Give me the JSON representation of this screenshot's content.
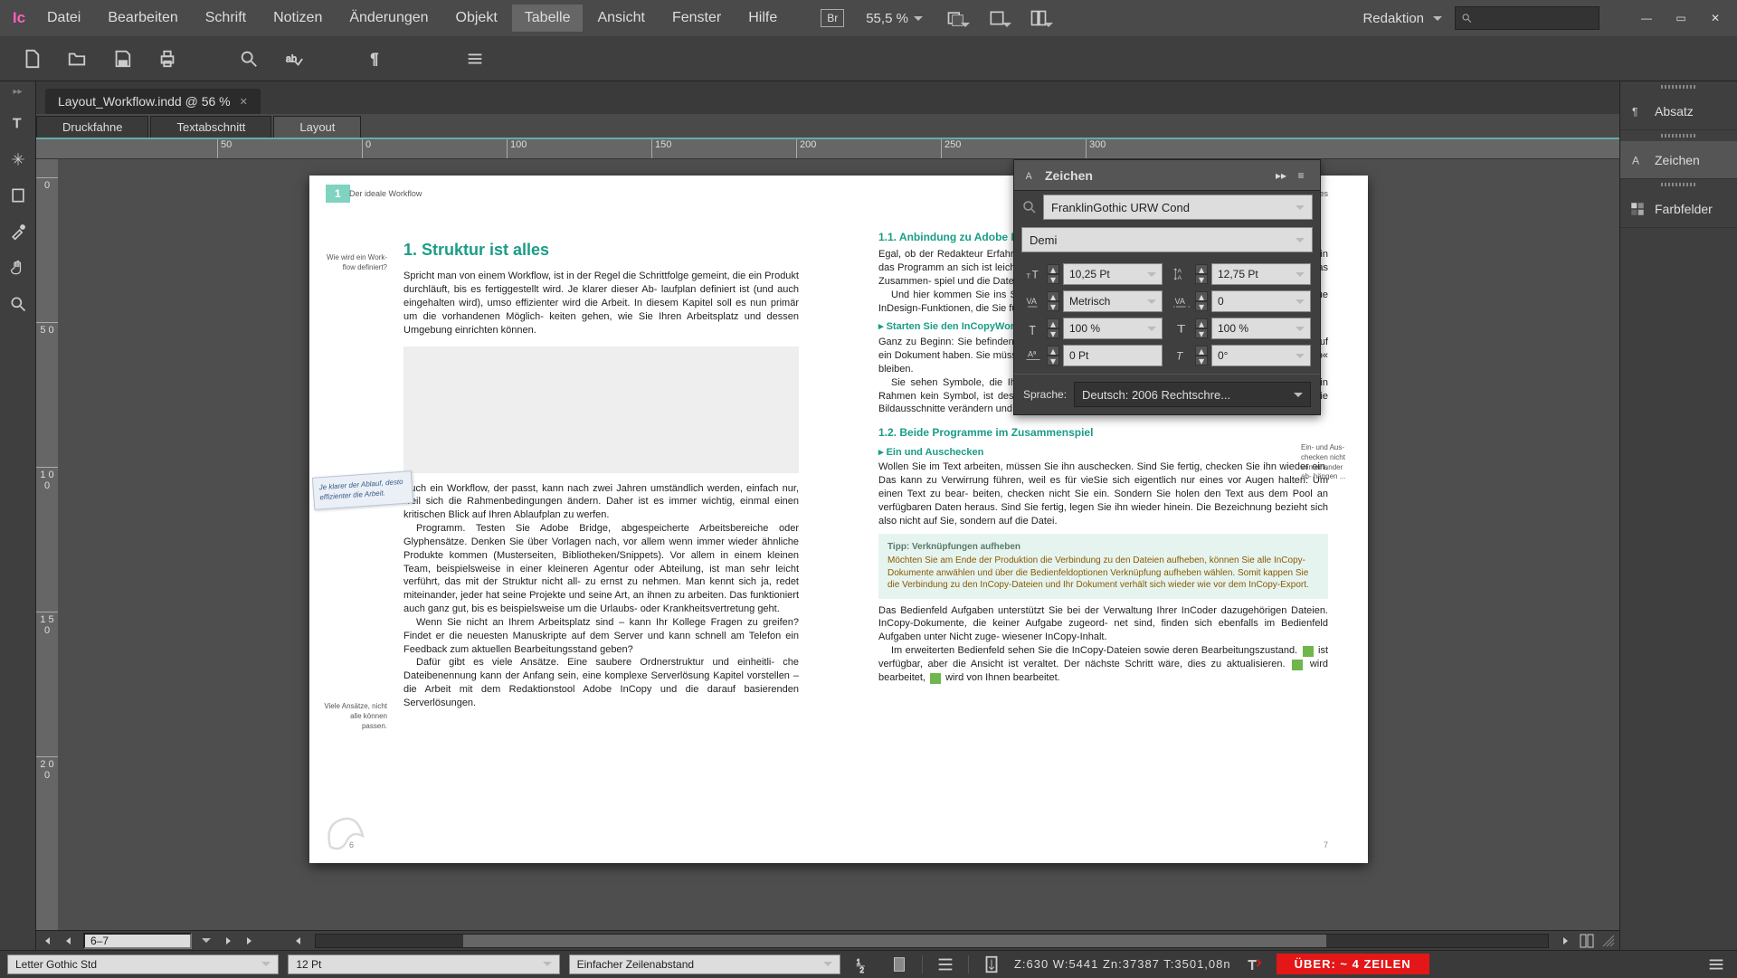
{
  "app": {
    "icon_label": "Ic"
  },
  "menu": [
    "Datei",
    "Bearbeiten",
    "Schrift",
    "Notizen",
    "Änderungen",
    "Objekt",
    "Tabelle",
    "Ansicht",
    "Fenster",
    "Hilfe"
  ],
  "menu_highlight": 6,
  "br_badge": "Br",
  "zoom": "55,5 %",
  "workspace_label": "Redaktion",
  "search_placeholder": "",
  "window_buttons": {
    "minimize": "—",
    "maximize": "▭",
    "close": "✕"
  },
  "document_tab": {
    "name": "Layout_Workflow.indd @ 56 %"
  },
  "view_tabs": [
    "Druckfahne",
    "Textabschnitt",
    "Layout"
  ],
  "view_tab_active": 2,
  "ruler_h": [
    "50",
    "100",
    "150",
    "200",
    "250",
    "300"
  ],
  "ruler_v": [
    "0",
    "5 0",
    "1 0 0",
    "1 5 0",
    "2 0 0"
  ],
  "page_nav": {
    "current": "6–7"
  },
  "left_page": {
    "chapmark": "1",
    "running": "Der ideale Workflow",
    "h1": "1.  Struktur ist alles",
    "marg1": "Wie wird ein Work- flow definiert?",
    "p1": "Spricht man von einem Workflow, ist in der Regel die Schrittfolge gemeint, die ein Produkt durchläuft, bis es fertiggestellt wird. Je klarer dieser Ab- laufplan definiert ist (und auch eingehalten wird), umso effizienter wird die Arbeit. In diesem Kapitel soll es nun primär um die vorhandenen Möglich- keiten gehen, wie Sie Ihren Arbeitsplatz und dessen Umgebung einrichten können.",
    "sticky": "Je klarer der Ablauf, desto effizienter die Arbeit.",
    "p2": "Auch ein Workflow, der passt, kann nach zwei Jahren umständlich werden, einfach nur, weil sich die Rahmenbedingungen ändern. Daher ist es immer wichtig, einmal einen kritischen Blick auf Ihren Ablaufplan zu werfen.",
    "p3": "Programm. Testen Sie Adobe Bridge, abgespeicherte Arbeitsbereiche oder Glyphensätze. Denken Sie über Vorlagen nach, vor allem wenn immer wieder ähnliche Produkte kommen (Musterseiten, Bibliotheken/Snippets). Vor allem in einem kleinen Team, beispielsweise in einer kleineren Agentur oder Abteilung, ist man sehr leicht verführt, das mit der Struktur nicht all- zu ernst zu nehmen. Man kennt sich ja, redet miteinander, jeder hat seine Projekte und seine Art, an ihnen zu arbeiten. Das funktioniert auch ganz gut, bis es beispielsweise um die Urlaubs- oder Krankheitsvertretung geht.",
    "p4": "Wenn Sie nicht an Ihrem Arbeitsplatz sind – kann Ihr Kollege Fragen zu greifen? Findet er die neuesten Manuskripte auf dem Server und kann schnell am Telefon ein Feedback zum aktuellen Bearbeitungsstand geben?",
    "marg2": "Viele Ansätze, nicht alle können passen.",
    "p5": "Dafür gibt es viele Ansätze. Eine saubere Ordnerstruktur und einheitli- che Dateibenennung kann der Anfang sein, eine komplexe Serverlösung Kapitel vorstellen – die Arbeit mit dem Redaktionstool Adobe InCopy und die darauf basierenden Serverlösungen.",
    "foot": "6"
  },
  "right_page": {
    "running": "Struktur ist alles",
    "h2a": "1.1.  Anbindung zu Adobe InCopy",
    "p1": "Egal, ob der Redakteur Erfahrungen in InDesign hat oder lediglich Word-Kenntnisse: Der Einstieg in das Programm an sich ist leicht. Worauf sich Redakteur und Layouter aber einstellen müssen, ist das Zusammen- spiel und die Dateiverwaltung der Programme.",
    "p1b": "Und hier kommen Sie ins Spiel. Für Sie als Layouter gibt es ein paar bekannte, aber auch neue InDesign-Funktionen, die Sie für den InCopyWorkflow benötigen.",
    "h3a": "▸  Starten Sie den InCopyWorkflow",
    "p2": "Ganz zu Beginn: Sie befinden sich gleich in einem Workflow, in dem meh- rere Kollegen Zugriff auf ein Dokument haben. Sie müssen sich in diesem Workflow identifizieren und können nicht »inkognito« bleiben.",
    "p2b": "Sie sehen Symbole, die Ihnen anzeigen, ob der Text zur Verfügung steht oder nicht. Hat ein Rahmen kein Symbol, ist dessen Inhalt nicht freigege- dann mit dem Positionierungswerkzeug die Bildausschnitte verändern und in den vorhandenen Rahmen neue Bilder platzieren.",
    "h2b": "1.2.  Beide Programme im Zusammenspiel",
    "h3b": "▸  Ein und Auschecken",
    "p3": "Wollen Sie im Text arbeiten, müssen Sie ihn auschecken. Sind Sie fertig, checken Sie ihn wieder ein. Das kann zu Verwirrung führen, weil es für vieSie sich eigentlich nur eines vor Augen halten: Um einen Text zu bear- beiten, checken nicht Sie ein. Sondern Sie holen den Text aus dem Pool an verfügbaren Daten heraus. Sind Sie fertig, legen Sie ihn wieder hinein. Die Bezeichnung bezieht sich also nicht auf Sie, sondern auf die Datei.",
    "rmarg": "Ein- und Aus- checken nicht von einander ab- hängen ...",
    "tip_head": "Tipp: Verknüpfungen aufheben",
    "tip_body": "Möchten Sie am Ende der Produktion die Verbindung zu den Dateien aufheben, können Sie alle InCopy-Dokumente anwählen und über die Bedienfeldoptionen Verknüpfung aufheben wählen. Somit kappen Sie die Verbindung zu den InCopy-Dateien und Ihr Dokument verhält sich wieder wie vor dem InCopy-Export.",
    "p4": "Das Bedienfeld Aufgaben unterstützt Sie bei der Verwaltung Ihrer InCoder dazugehörigen Dateien. InCopy-Dokumente, die keiner Aufgabe zugeord- net sind, finden sich ebenfalls im Bedienfeld Aufgaben unter Nicht zuge- wiesener InCopy-Inhalt.",
    "p5a": "Im erweiterten Bedienfeld sehen Sie die InCopy-Dateien sowie deren Bearbeitungszustand.",
    "p5b": " ist verfügbar, aber die Ansicht ist veraltet. Der nächste Schritt wäre, dies zu aktualisieren. ",
    "p5c": " wird bearbeitet, ",
    "p5d": " wird von Ihnen bearbeitet.",
    "foot": "7"
  },
  "char_panel": {
    "title": "Zeichen",
    "font": "FranklinGothic URW Cond",
    "weight": "Demi",
    "size": "10,25 Pt",
    "leading": "12,75 Pt",
    "kerning": "Metrisch",
    "tracking": "0",
    "vscale": "100 %",
    "hscale": "100 %",
    "baseline": "0 Pt",
    "skew": "0°",
    "lang_label": "Sprache:",
    "lang": "Deutsch: 2006 Rechtschre..."
  },
  "dock": {
    "items": [
      "Absatz",
      "Zeichen",
      "Farbfelder"
    ],
    "active": 1
  },
  "status": {
    "font": "Letter Gothic Std",
    "size": "12 Pt",
    "leading": "Einfacher Zeilenabstand",
    "counts": "Z:630    W:5441    Zn:37387  T:3501,08n",
    "overset": "ÜBER:  ~ 4 ZEILEN"
  }
}
